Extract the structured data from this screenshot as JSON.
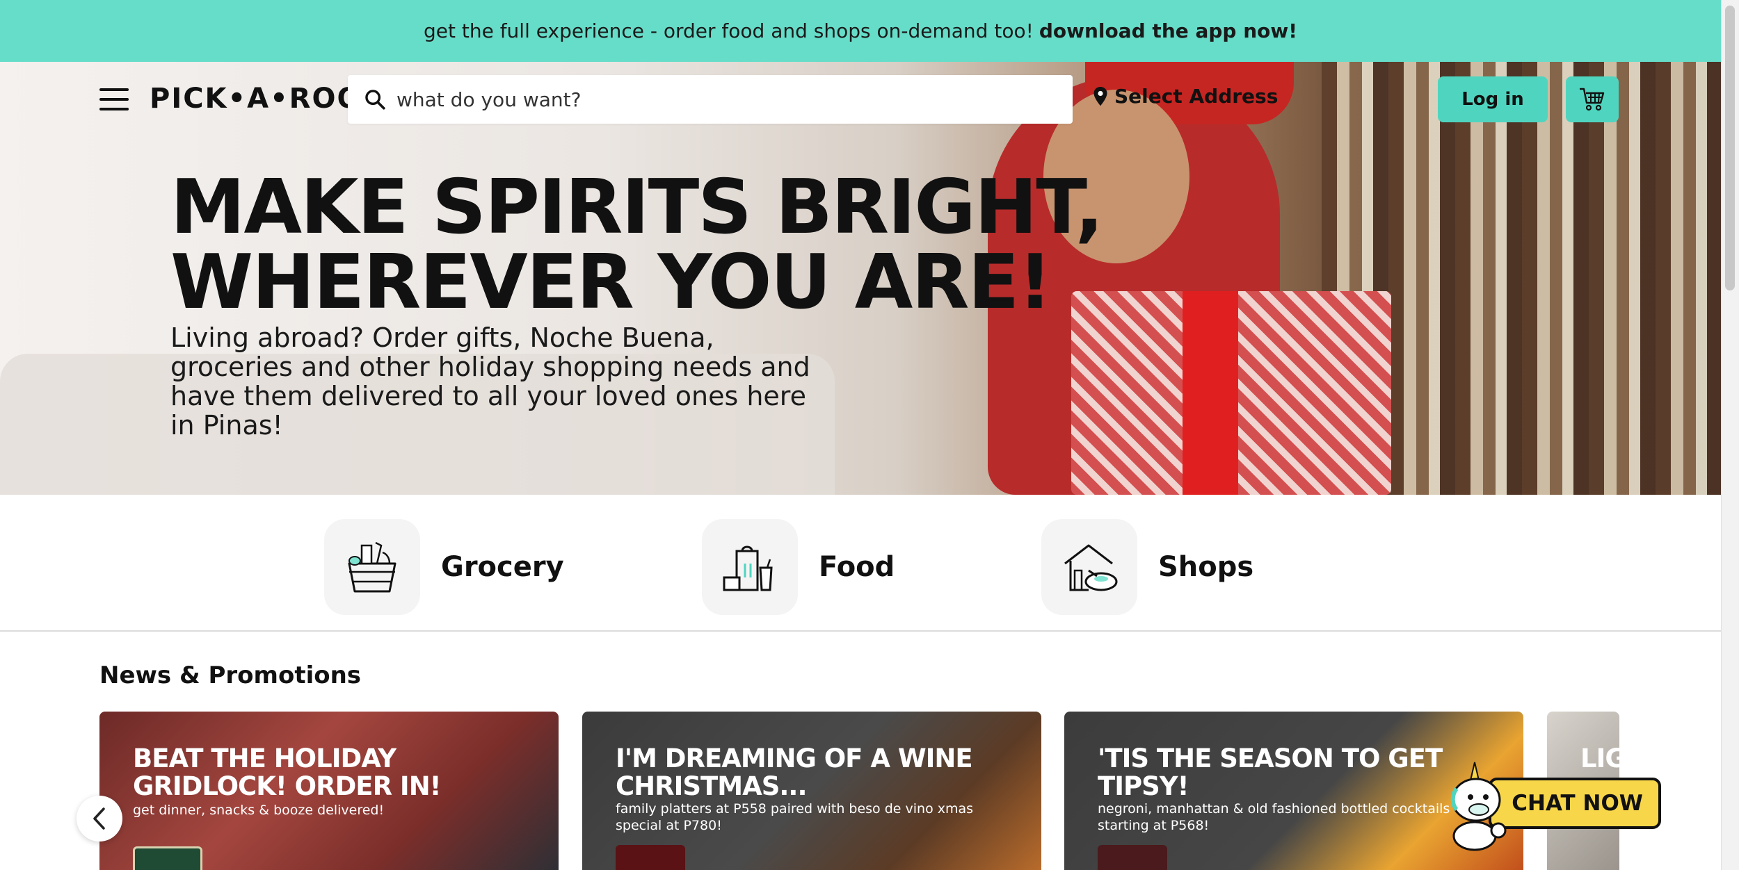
{
  "app_banner": {
    "text": "get the full experience - order food and shops on-demand too!",
    "cta": "download the app now!"
  },
  "header": {
    "logo": "PICK•A•ROO",
    "search_placeholder": "what do you want?",
    "address_label": "Select Address",
    "login_label": "Log in"
  },
  "hero": {
    "title_line1": "MAKE SPIRITS BRIGHT,",
    "title_line2": "WHEREVER YOU ARE!",
    "subtitle": "Living abroad? Order gifts, Noche Buena, groceries and other holiday shopping needs and have them delivered to all your loved ones here in Pinas!"
  },
  "categories": [
    {
      "label": "Grocery",
      "icon": "grocery-basket-icon"
    },
    {
      "label": "Food",
      "icon": "food-bag-icon"
    },
    {
      "label": "Shops",
      "icon": "shop-house-icon"
    }
  ],
  "news": {
    "title": "News & Promotions",
    "cards": [
      {
        "title": "BEAT THE HOLIDAY GRIDLOCK! ORDER IN!",
        "subtitle": "get dinner, snacks & booze delivered!"
      },
      {
        "title": "I'M DREAMING OF A WINE CHRISTMAS...",
        "subtitle": "family platters at P558 paired with beso de vino xmas special at P780!"
      },
      {
        "title": "'TIS THE SEASON TO GET TIPSY!",
        "subtitle": "negroni, manhattan & old fashioned bottled cocktails starting at P568!"
      },
      {
        "title": "LIG",
        "subtitle": ""
      }
    ]
  },
  "chat": {
    "label": "CHAT NOW"
  },
  "colors": {
    "brand_teal": "#66ddc9",
    "button_teal": "#4fd5bf",
    "chat_yellow": "#f7d64a"
  }
}
